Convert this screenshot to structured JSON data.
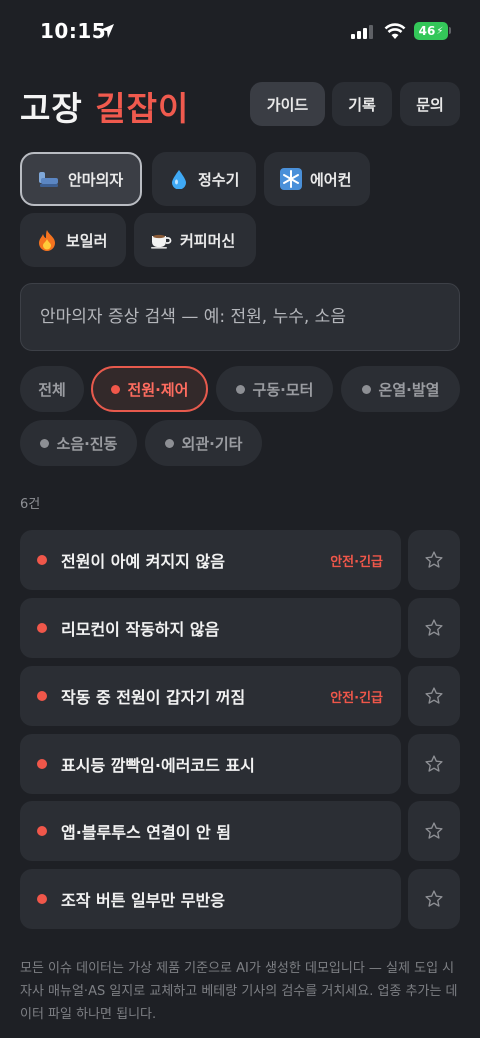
{
  "status_bar": {
    "time": "10:15",
    "battery": "46"
  },
  "header": {
    "title_part1": "고장",
    "title_part2": "길잡이",
    "nav": [
      {
        "label": "가이드",
        "active": true
      },
      {
        "label": "기록",
        "active": false
      },
      {
        "label": "문의",
        "active": false
      }
    ]
  },
  "categories": [
    {
      "label": "안마의자",
      "icon": "massage-chair-icon",
      "active": true
    },
    {
      "label": "정수기",
      "icon": "water-drop-icon",
      "active": false
    },
    {
      "label": "에어컨",
      "icon": "snowflake-icon",
      "active": false
    },
    {
      "label": "보일러",
      "icon": "fire-icon",
      "active": false
    },
    {
      "label": "커피머신",
      "icon": "coffee-icon",
      "active": false
    }
  ],
  "search": {
    "placeholder": "안마의자 증상 검색 — 예: 전원, 누수, 소음"
  },
  "filters": [
    {
      "label": "전체",
      "dot": false,
      "active": false
    },
    {
      "label": "전원·제어",
      "dot": true,
      "active": true
    },
    {
      "label": "구동·모터",
      "dot": true,
      "active": false
    },
    {
      "label": "온열·발열",
      "dot": true,
      "active": false
    },
    {
      "label": "소음·진동",
      "dot": true,
      "active": false
    },
    {
      "label": "외관·기타",
      "dot": true,
      "active": false
    }
  ],
  "result_count": "6건",
  "issues": [
    {
      "title": "전원이 아예 켜지지 않음",
      "badge": "안전·긴급"
    },
    {
      "title": "리모컨이 작동하지 않음",
      "badge": ""
    },
    {
      "title": "작동 중 전원이 갑자기 꺼짐",
      "badge": "안전·긴급"
    },
    {
      "title": "표시등 깜빡임·에러코드 표시",
      "badge": ""
    },
    {
      "title": "앱·블루투스 연결이 안 됨",
      "badge": ""
    },
    {
      "title": "조작 버튼 일부만 무반응",
      "badge": ""
    }
  ],
  "footnote": "모든 이슈 데이터는 가상 제품 기준으로 AI가 생성한 데모입니다 — 실제 도입 시 자사 매뉴얼·AS 일지로 교체하고 베테랑 기사의 검수를 거치세요. 업종 추가는 데이터 파일 하나면 됩니다.",
  "colors": {
    "accent": "#f0574a",
    "background": "#1e2025",
    "surface": "#2b2e34"
  }
}
